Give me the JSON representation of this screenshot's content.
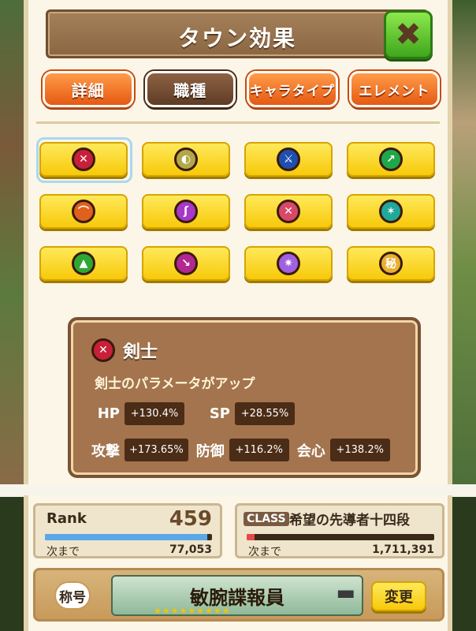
{
  "window": {
    "title": "タウン効果",
    "close_icon": "close-x-icon"
  },
  "tabs": [
    {
      "label": "詳細",
      "active": false
    },
    {
      "label": "職種",
      "active": true
    },
    {
      "label": "キャラタイプ",
      "active": false
    },
    {
      "label": "エレメント",
      "active": false
    }
  ],
  "jobs": [
    {
      "icon": "sword-icon",
      "color": "#c8203a",
      "glyph": "✕",
      "selected": true
    },
    {
      "icon": "bread-icon",
      "color": "#b2a84a",
      "glyph": "◐",
      "selected": false
    },
    {
      "icon": "axe-icon",
      "color": "#1e4fb0",
      "glyph": "⚔",
      "selected": false
    },
    {
      "icon": "dagger-icon",
      "color": "#1fa84a",
      "glyph": "↗",
      "selected": false
    },
    {
      "icon": "bow-icon",
      "color": "#e0601e",
      "glyph": "⌒",
      "selected": false
    },
    {
      "icon": "staff-icon",
      "color": "#a838c8",
      "glyph": "ʃ",
      "selected": false
    },
    {
      "icon": "twin-blades-icon",
      "color": "#d84868",
      "glyph": "✕",
      "selected": false
    },
    {
      "icon": "dragon-icon",
      "color": "#20a89a",
      "glyph": "✶",
      "selected": false
    },
    {
      "icon": "shield-icon",
      "color": "#2ea832",
      "glyph": "▲",
      "selected": false
    },
    {
      "icon": "hammer-icon",
      "color": "#b02890",
      "glyph": "↘",
      "selected": false
    },
    {
      "icon": "secret-blade-icon",
      "color": "#a060e0",
      "glyph": "✷",
      "selected": false
    },
    {
      "icon": "secret-scroll-icon",
      "color": "#e8b030",
      "glyph": "秘",
      "selected": false
    }
  ],
  "info": {
    "icon": "sword-icon",
    "name": "剣士",
    "description": "剣士のパラメータがアップ",
    "stats": {
      "hp": {
        "label": "HP",
        "value": "+130.4%"
      },
      "sp": {
        "label": "SP",
        "value": "+28.55%"
      },
      "atk": {
        "label": "攻撃",
        "value": "+173.65%"
      },
      "def": {
        "label": "防御",
        "value": "+116.2%"
      },
      "crit": {
        "label": "会心",
        "value": "+138.2%"
      }
    }
  },
  "status": {
    "rank": {
      "label": "Rank",
      "value": "459",
      "next_label": "次まで",
      "next_value": "77,053",
      "progress": 0.97,
      "bar_color": "#5aa8e8"
    },
    "class": {
      "label": "CLASS",
      "value": "希望の先導者十四段",
      "next_label": "次まで",
      "next_value": "1,711,391",
      "progress": 0.04,
      "bar_color": "#e84848"
    }
  },
  "title_plate": {
    "badge": "称号",
    "name": "敏腕諜報員",
    "stars": "★★★★★★★★★",
    "change_label": "変更",
    "gun_icon": "pistol-icon"
  }
}
